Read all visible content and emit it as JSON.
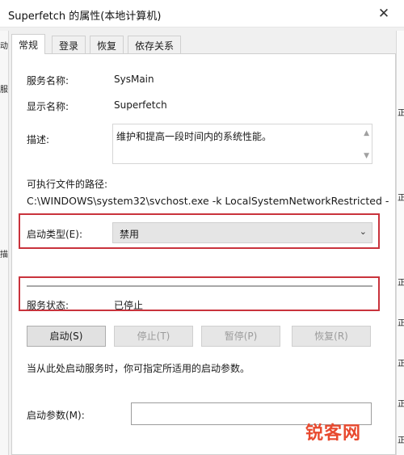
{
  "window": {
    "title": "Superfetch 的属性(本地计算机)",
    "close_glyph": "✕"
  },
  "tabs": [
    {
      "label": "常规",
      "active": true
    },
    {
      "label": "登录",
      "active": false
    },
    {
      "label": "恢复",
      "active": false
    },
    {
      "label": "依存关系",
      "active": false
    }
  ],
  "general": {
    "service_name_label": "服务名称:",
    "service_name_value": "SysMain",
    "display_name_label": "显示名称:",
    "display_name_value": "Superfetch",
    "description_label": "描述:",
    "description_value": "维护和提高一段时间内的系统性能。",
    "path_label": "可执行文件的路径:",
    "path_value": "C:\\WINDOWS\\system32\\svchost.exe -k LocalSystemNetworkRestricted -",
    "startup_type_label": "启动类型(E):",
    "startup_type_value": "禁用",
    "service_status_label": "服务状态:",
    "service_status_value": "已停止",
    "buttons": {
      "start": "启动(S)",
      "stop": "停止(T)",
      "pause": "暂停(P)",
      "resume": "恢复(R)"
    },
    "hint": "当从此处启动服务时，你可指定所适用的启动参数。",
    "start_params_label": "启动参数(M):",
    "start_params_value": ""
  },
  "background": {
    "left_fragments": [
      "动",
      "服",
      "描"
    ],
    "right_fragments": [
      "正",
      "正",
      "正",
      "正",
      "正",
      "正",
      "正"
    ]
  },
  "watermark": "锐客网",
  "colors": {
    "highlight_border": "#c9333c",
    "watermark": "#e84a2f"
  },
  "icons": {
    "close": "close-icon",
    "dropdown": "chevron-down-icon",
    "scroll_up": "scroll-up-icon",
    "scroll_down": "scroll-down-icon"
  }
}
